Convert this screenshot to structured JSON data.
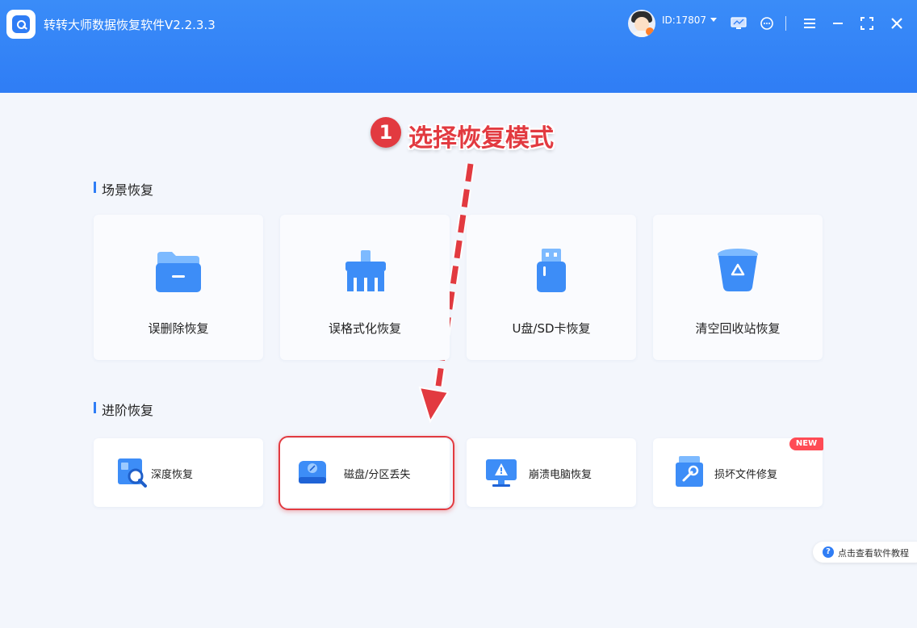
{
  "app": {
    "title": "转转大师数据恢复软件V2.2.3.3",
    "user_id": "ID:17807"
  },
  "header_icons": [
    "screen-icon",
    "support-icon",
    "menu-icon",
    "minimize-icon",
    "maximize-icon",
    "close-icon"
  ],
  "annotation": {
    "step_number": "1",
    "text": "选择恢复模式"
  },
  "scene_recovery": {
    "title": "场景恢复",
    "items": [
      {
        "label": "误删除恢复",
        "icon": "folder-icon"
      },
      {
        "label": "误格式化恢复",
        "icon": "broom-icon"
      },
      {
        "label": "U盘/SD卡恢复",
        "icon": "usb-drive-icon"
      },
      {
        "label": "清空回收站恢复",
        "icon": "recycle-bin-icon"
      }
    ]
  },
  "advanced_recovery": {
    "title": "进阶恢复",
    "items": [
      {
        "label": "深度恢复",
        "icon": "deep-scan-icon"
      },
      {
        "label": "磁盘/分区丢失",
        "icon": "disk-icon"
      },
      {
        "label": "崩溃电脑恢复",
        "icon": "crashed-computer-icon"
      },
      {
        "label": "损坏文件修复",
        "icon": "repair-icon"
      }
    ],
    "new_badge": "NEW"
  },
  "help": {
    "label": "点击查看软件教程"
  },
  "colors": {
    "brand_blue": "#2f7df5",
    "annotation_red": "#e23a40",
    "background": "#f3f6fc"
  }
}
